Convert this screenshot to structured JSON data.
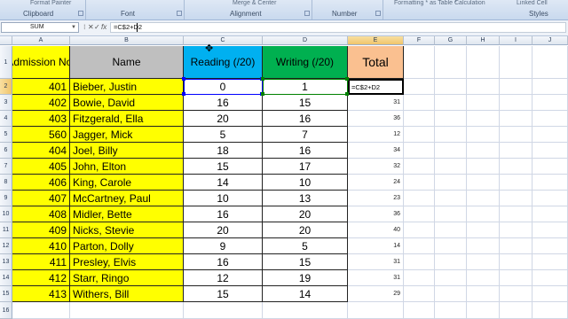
{
  "ribbon": {
    "fragments": {
      "format_painter": "Format Painter",
      "merge_center": "Merge & Center",
      "formatting_table": "Formatting * as Table *",
      "calculation": "Calculation",
      "linked_cell": "Linked Cell"
    },
    "groups": {
      "clipboard": "Clipboard",
      "font": "Font",
      "alignment": "Alignment",
      "number": "Number",
      "styles": "Styles"
    }
  },
  "formula_bar": {
    "name_box": "SUM",
    "cancel_glyph": "✕",
    "enter_glyph": "✓",
    "fx_glyph": "fx",
    "formula": "=C$2+D2"
  },
  "columns": [
    "A",
    "B",
    "C",
    "D",
    "E",
    "F",
    "G",
    "H",
    "I",
    "J"
  ],
  "rows": [
    "1",
    "2",
    "3",
    "4",
    "5",
    "6",
    "7",
    "8",
    "9",
    "10",
    "11",
    "12",
    "13",
    "14",
    "15",
    "16"
  ],
  "headers": {
    "admission": "Admission No.",
    "name": "Name",
    "reading": "Reading (/20)",
    "writing": "Writing (/20)",
    "total": "Total"
  },
  "students": [
    {
      "no": "401",
      "name": "Bieber, Justin",
      "reading": "0",
      "writing": "1",
      "total": "=C$2+D2"
    },
    {
      "no": "402",
      "name": "Bowie, David",
      "reading": "16",
      "writing": "15",
      "total": "31"
    },
    {
      "no": "403",
      "name": "Fitzgerald, Ella",
      "reading": "20",
      "writing": "16",
      "total": "36"
    },
    {
      "no": "560",
      "name": "Jagger, Mick",
      "reading": "5",
      "writing": "7",
      "total": "12"
    },
    {
      "no": "404",
      "name": "Joel, Billy",
      "reading": "18",
      "writing": "16",
      "total": "34"
    },
    {
      "no": "405",
      "name": "John, Elton",
      "reading": "15",
      "writing": "17",
      "total": "32"
    },
    {
      "no": "406",
      "name": "King, Carole",
      "reading": "14",
      "writing": "10",
      "total": "24"
    },
    {
      "no": "407",
      "name": "McCartney, Paul",
      "reading": "10",
      "writing": "13",
      "total": "23"
    },
    {
      "no": "408",
      "name": "Midler, Bette",
      "reading": "16",
      "writing": "20",
      "total": "36"
    },
    {
      "no": "409",
      "name": "Nicks, Stevie",
      "reading": "20",
      "writing": "20",
      "total": "40"
    },
    {
      "no": "410",
      "name": "Parton, Dolly",
      "reading": "9",
      "writing": "5",
      "total": "14"
    },
    {
      "no": "411",
      "name": "Presley, Elvis",
      "reading": "16",
      "writing": "15",
      "total": "31"
    },
    {
      "no": "412",
      "name": "Starr, Ringo",
      "reading": "12",
      "writing": "19",
      "total": "31"
    },
    {
      "no": "413",
      "name": "Withers, Bill",
      "reading": "15",
      "writing": "14",
      "total": "29"
    }
  ],
  "colors": {
    "admission_fill": "#ffff00",
    "name_header_fill": "#bfbfbf",
    "reading_header_fill": "#00b0f0",
    "writing_header_fill": "#00b050",
    "total_header_fill": "#fac090",
    "range_highlight": "#0000ff"
  }
}
